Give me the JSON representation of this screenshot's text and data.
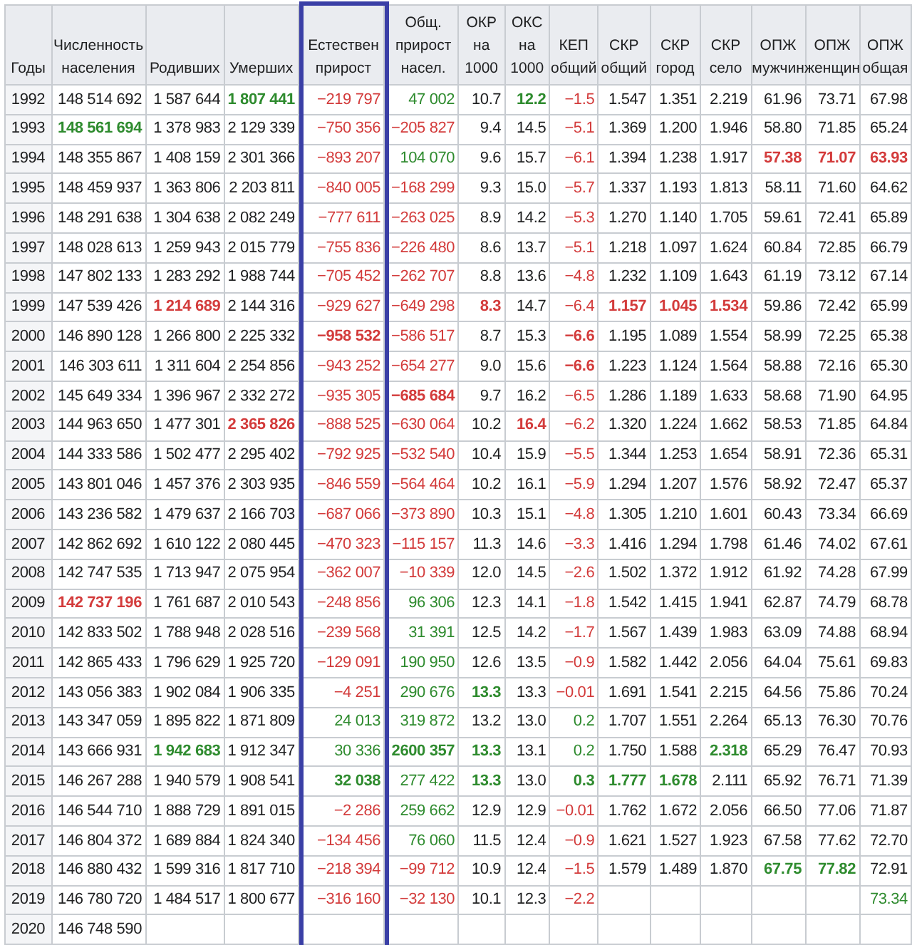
{
  "columns": [
    {
      "header": "Годы",
      "outlined": false
    },
    {
      "header": "Численность населения",
      "outlined": false
    },
    {
      "header": "Родивших",
      "outlined": false
    },
    {
      "header": "Умерших",
      "outlined": false
    },
    {
      "header": "Естествен прирост",
      "outlined": true
    },
    {
      "header": "Общ. прирост насел.",
      "outlined": false
    },
    {
      "header": "ОКР на 1000",
      "outlined": false
    },
    {
      "header": "ОКС на 1000",
      "outlined": false
    },
    {
      "header": "КЕП общий",
      "outlined": false
    },
    {
      "header": "СКР общий",
      "outlined": false
    },
    {
      "header": "СКР город",
      "outlined": false
    },
    {
      "header": "СКР село",
      "outlined": false
    },
    {
      "header": "ОПЖ мужчин",
      "outlined": false
    },
    {
      "header": "ОПЖ женщин",
      "outlined": false
    },
    {
      "header": "ОПЖ общая",
      "outlined": false
    }
  ],
  "rows": [
    {
      "cells": [
        "1992",
        "148 514 692",
        "1 587 644",
        {
          "text": "1 807 441",
          "color": "#2e8b2e",
          "bold": true
        },
        {
          "text": "−219 797",
          "color": "#d33b3b"
        },
        {
          "text": "47 002",
          "color": "#2e8b2e"
        },
        "10.7",
        {
          "text": "12.2",
          "color": "#2e8b2e",
          "bold": true
        },
        {
          "text": "−1.5",
          "color": "#d33b3b"
        },
        "1.547",
        "1.351",
        "2.219",
        "61.96",
        "73.71",
        "67.98"
      ]
    },
    {
      "cells": [
        "1993",
        {
          "text": "148 561 694",
          "color": "#2e8b2e",
          "bold": true
        },
        "1 378 983",
        "2 129 339",
        {
          "text": "−750 356",
          "color": "#d33b3b"
        },
        {
          "text": "−205 827",
          "color": "#d33b3b"
        },
        "9.4",
        "14.5",
        {
          "text": "−5.1",
          "color": "#d33b3b"
        },
        "1.369",
        "1.200",
        "1.946",
        "58.80",
        "71.85",
        "65.24"
      ]
    },
    {
      "cells": [
        "1994",
        "148 355 867",
        "1 408 159",
        "2 301 366",
        {
          "text": "−893 207",
          "color": "#d33b3b"
        },
        {
          "text": "104 070",
          "color": "#2e8b2e"
        },
        "9.6",
        "15.7",
        {
          "text": "−6.1",
          "color": "#d33b3b"
        },
        "1.394",
        "1.238",
        "1.917",
        {
          "text": "57.38",
          "color": "#d33b3b",
          "bold": true
        },
        {
          "text": "71.07",
          "color": "#d33b3b",
          "bold": true
        },
        {
          "text": "63.93",
          "color": "#d33b3b",
          "bold": true
        }
      ]
    },
    {
      "cells": [
        "1995",
        "148 459 937",
        "1 363 806",
        "2 203 811",
        {
          "text": "−840 005",
          "color": "#d33b3b"
        },
        {
          "text": "−168 299",
          "color": "#d33b3b"
        },
        "9.3",
        "15.0",
        {
          "text": "−5.7",
          "color": "#d33b3b"
        },
        "1.337",
        "1.193",
        "1.813",
        "58.11",
        "71.60",
        "64.62"
      ]
    },
    {
      "cells": [
        "1996",
        "148 291 638",
        "1 304 638",
        "2 082 249",
        {
          "text": "−777 611",
          "color": "#d33b3b"
        },
        {
          "text": "−263 025",
          "color": "#d33b3b"
        },
        "8.9",
        "14.2",
        {
          "text": "−5.3",
          "color": "#d33b3b"
        },
        "1.270",
        "1.140",
        "1.705",
        "59.61",
        "72.41",
        "65.89"
      ]
    },
    {
      "cells": [
        "1997",
        "148 028 613",
        "1 259 943",
        "2 015 779",
        {
          "text": "−755 836",
          "color": "#d33b3b"
        },
        {
          "text": "−226 480",
          "color": "#d33b3b"
        },
        "8.6",
        "13.7",
        {
          "text": "−5.1",
          "color": "#d33b3b"
        },
        "1.218",
        "1.097",
        "1.624",
        "60.84",
        "72.85",
        "66.79"
      ]
    },
    {
      "cells": [
        "1998",
        "147 802 133",
        "1 283 292",
        "1 988 744",
        {
          "text": "−705 452",
          "color": "#d33b3b"
        },
        {
          "text": "−262 707",
          "color": "#d33b3b"
        },
        "8.8",
        "13.6",
        {
          "text": "−4.8",
          "color": "#d33b3b"
        },
        "1.232",
        "1.109",
        "1.643",
        "61.19",
        "73.12",
        "67.14"
      ]
    },
    {
      "cells": [
        "1999",
        "147 539 426",
        {
          "text": "1 214 689",
          "color": "#d33b3b",
          "bold": true
        },
        "2 144 316",
        {
          "text": "−929 627",
          "color": "#d33b3b"
        },
        {
          "text": "−649 298",
          "color": "#d33b3b"
        },
        {
          "text": "8.3",
          "color": "#d33b3b",
          "bold": true
        },
        "14.7",
        {
          "text": "−6.4",
          "color": "#d33b3b"
        },
        {
          "text": "1.157",
          "color": "#d33b3b",
          "bold": true
        },
        {
          "text": "1.045",
          "color": "#d33b3b",
          "bold": true
        },
        {
          "text": "1.534",
          "color": "#d33b3b",
          "bold": true
        },
        "59.86",
        "72.42",
        "65.99"
      ]
    },
    {
      "cells": [
        "2000",
        "146 890 128",
        "1 266 800",
        "2 225 332",
        {
          "text": "−958 532",
          "color": "#d33b3b",
          "bold": true
        },
        {
          "text": "−586 517",
          "color": "#d33b3b"
        },
        "8.7",
        "15.3",
        {
          "text": "−6.6",
          "color": "#d33b3b",
          "bold": true
        },
        "1.195",
        "1.089",
        "1.554",
        "58.99",
        "72.25",
        "65.38"
      ]
    },
    {
      "cells": [
        "2001",
        "146 303 611",
        "1 311 604",
        "2 254 856",
        {
          "text": "−943 252",
          "color": "#d33b3b"
        },
        {
          "text": "−654 277",
          "color": "#d33b3b"
        },
        "9.0",
        "15.6",
        {
          "text": "−6.6",
          "color": "#d33b3b",
          "bold": true
        },
        "1.223",
        "1.124",
        "1.564",
        "58.88",
        "72.16",
        "65.30"
      ]
    },
    {
      "cells": [
        "2002",
        "145 649 334",
        "1 396 967",
        "2 332 272",
        {
          "text": "−935 305",
          "color": "#d33b3b"
        },
        {
          "text": "−685 684",
          "color": "#d33b3b",
          "bold": true
        },
        "9.7",
        "16.2",
        {
          "text": "−6.5",
          "color": "#d33b3b"
        },
        "1.286",
        "1.189",
        "1.633",
        "58.68",
        "71.90",
        "64.95"
      ]
    },
    {
      "cells": [
        "2003",
        "144 963 650",
        "1 477 301",
        {
          "text": "2 365 826",
          "color": "#d33b3b",
          "bold": true
        },
        {
          "text": "−888 525",
          "color": "#d33b3b"
        },
        {
          "text": "−630 064",
          "color": "#d33b3b"
        },
        "10.2",
        {
          "text": "16.4",
          "color": "#d33b3b",
          "bold": true
        },
        {
          "text": "−6.2",
          "color": "#d33b3b"
        },
        "1.320",
        "1.224",
        "1.662",
        "58.53",
        "71.85",
        "64.84"
      ]
    },
    {
      "cells": [
        "2004",
        "144 333 586",
        "1 502 477",
        "2 295 402",
        {
          "text": "−792 925",
          "color": "#d33b3b"
        },
        {
          "text": "−532 540",
          "color": "#d33b3b"
        },
        "10.4",
        "15.9",
        {
          "text": "−5.5",
          "color": "#d33b3b"
        },
        "1.344",
        "1.253",
        "1.654",
        "58.91",
        "72.36",
        "65.31"
      ]
    },
    {
      "cells": [
        "2005",
        "143 801 046",
        "1 457 376",
        "2 303 935",
        {
          "text": "−846 559",
          "color": "#d33b3b"
        },
        {
          "text": "−564 464",
          "color": "#d33b3b"
        },
        "10.2",
        "16.1",
        {
          "text": "−5.9",
          "color": "#d33b3b"
        },
        "1.294",
        "1.207",
        "1.576",
        "58.92",
        "72.47",
        "65.37"
      ]
    },
    {
      "cells": [
        "2006",
        "143 236 582",
        "1 479 637",
        "2 166 703",
        {
          "text": "−687 066",
          "color": "#d33b3b"
        },
        {
          "text": "−373 890",
          "color": "#d33b3b"
        },
        "10.3",
        "15.1",
        {
          "text": "−4.8",
          "color": "#d33b3b"
        },
        "1.305",
        "1.210",
        "1.601",
        "60.43",
        "73.34",
        "66.69"
      ]
    },
    {
      "cells": [
        "2007",
        "142 862 692",
        "1 610 122",
        "2 080 445",
        {
          "text": "−470 323",
          "color": "#d33b3b"
        },
        {
          "text": "−115 157",
          "color": "#d33b3b"
        },
        "11.3",
        "14.6",
        {
          "text": "−3.3",
          "color": "#d33b3b"
        },
        "1.416",
        "1.294",
        "1.798",
        "61.46",
        "74.02",
        "67.61"
      ]
    },
    {
      "cells": [
        "2008",
        "142 747 535",
        "1 713 947",
        "2 075 954",
        {
          "text": "−362 007",
          "color": "#d33b3b"
        },
        {
          "text": "−10 339",
          "color": "#d33b3b"
        },
        "12.0",
        "14.5",
        {
          "text": "−2.6",
          "color": "#d33b3b"
        },
        "1.502",
        "1.372",
        "1.912",
        "61.92",
        "74.28",
        "67.99"
      ]
    },
    {
      "cells": [
        "2009",
        {
          "text": "142 737 196",
          "color": "#d33b3b",
          "bold": true
        },
        "1 761 687",
        "2 010 543",
        {
          "text": "−248 856",
          "color": "#d33b3b"
        },
        {
          "text": "96 306",
          "color": "#2e8b2e"
        },
        "12.3",
        "14.1",
        {
          "text": "−1.8",
          "color": "#d33b3b"
        },
        "1.542",
        "1.415",
        "1.941",
        "62.87",
        "74.79",
        "68.78"
      ]
    },
    {
      "cells": [
        "2010",
        "142 833 502",
        "1 788 948",
        "2 028 516",
        {
          "text": "−239 568",
          "color": "#d33b3b"
        },
        {
          "text": "31 391",
          "color": "#2e8b2e"
        },
        "12.5",
        "14.2",
        {
          "text": "−1.7",
          "color": "#d33b3b"
        },
        "1.567",
        "1.439",
        "1.983",
        "63.09",
        "74.88",
        "68.94"
      ]
    },
    {
      "cells": [
        "2011",
        "142 865 433",
        "1 796 629",
        "1 925 720",
        {
          "text": "−129 091",
          "color": "#d33b3b"
        },
        {
          "text": "190 950",
          "color": "#2e8b2e"
        },
        "12.6",
        "13.5",
        {
          "text": "−0.9",
          "color": "#d33b3b"
        },
        "1.582",
        "1.442",
        "2.056",
        "64.04",
        "75.61",
        "69.83"
      ]
    },
    {
      "cells": [
        "2012",
        "143 056 383",
        "1 902 084",
        "1 906 335",
        {
          "text": "−4 251",
          "color": "#d33b3b"
        },
        {
          "text": "290 676",
          "color": "#2e8b2e"
        },
        {
          "text": "13.3",
          "color": "#2e8b2e",
          "bold": true
        },
        "13.3",
        {
          "text": "−0.01",
          "color": "#d33b3b"
        },
        "1.691",
        "1.541",
        "2.215",
        "64.56",
        "75.86",
        "70.24"
      ]
    },
    {
      "cells": [
        "2013",
        "143 347 059",
        "1 895 822",
        "1 871 809",
        {
          "text": "24 013",
          "color": "#2e8b2e"
        },
        {
          "text": "319 872",
          "color": "#2e8b2e"
        },
        "13.2",
        "13.0",
        {
          "text": "0.2",
          "color": "#2e8b2e"
        },
        "1.707",
        "1.551",
        "2.264",
        "65.13",
        "76.30",
        "70.76"
      ]
    },
    {
      "cells": [
        "2014",
        "143 666 931",
        {
          "text": "1 942 683",
          "color": "#2e8b2e",
          "bold": true
        },
        "1 912 347",
        {
          "text": "30 336",
          "color": "#2e8b2e"
        },
        {
          "text": "2600 357",
          "color": "#2e8b2e",
          "bold": true
        },
        {
          "text": "13.3",
          "color": "#2e8b2e",
          "bold": true
        },
        "13.1",
        {
          "text": "0.2",
          "color": "#2e8b2e"
        },
        "1.750",
        "1.588",
        {
          "text": "2.318",
          "color": "#2e8b2e",
          "bold": true
        },
        "65.29",
        "76.47",
        "70.93"
      ]
    },
    {
      "cells": [
        "2015",
        "146 267 288",
        "1 940 579",
        "1 908 541",
        {
          "text": "32 038",
          "color": "#2e8b2e",
          "bold": true
        },
        {
          "text": "277 422",
          "color": "#2e8b2e"
        },
        {
          "text": "13.3",
          "color": "#2e8b2e",
          "bold": true
        },
        "13.0",
        {
          "text": "0.3",
          "color": "#2e8b2e",
          "bold": true
        },
        {
          "text": "1.777",
          "color": "#2e8b2e",
          "bold": true
        },
        {
          "text": "1.678",
          "color": "#2e8b2e",
          "bold": true
        },
        "2.111",
        "65.92",
        "76.71",
        "71.39"
      ]
    },
    {
      "cells": [
        "2016",
        "146 544 710",
        "1 888 729",
        "1 891 015",
        {
          "text": "−2 286",
          "color": "#d33b3b"
        },
        {
          "text": "259 662",
          "color": "#2e8b2e"
        },
        "12.9",
        "12.9",
        {
          "text": "−0.01",
          "color": "#d33b3b"
        },
        "1.762",
        "1.672",
        "2.056",
        "66.50",
        "77.06",
        "71.87"
      ]
    },
    {
      "cells": [
        "2017",
        "146 804 372",
        "1 689 884",
        "1 824 340",
        {
          "text": "−134 456",
          "color": "#d33b3b"
        },
        {
          "text": "76 060",
          "color": "#2e8b2e"
        },
        "11.5",
        "12.4",
        {
          "text": "−0.9",
          "color": "#d33b3b"
        },
        "1.621",
        "1.527",
        "1.923",
        "67.58",
        "77.62",
        "72.70"
      ]
    },
    {
      "cells": [
        "2018",
        "146 880 432",
        "1 599 316",
        "1 817 710",
        {
          "text": "−218 394",
          "color": "#d33b3b"
        },
        {
          "text": "−99 712",
          "color": "#d33b3b"
        },
        "10.9",
        "12.4",
        {
          "text": "−1.5",
          "color": "#d33b3b"
        },
        "1.579",
        "1.489",
        "1.870",
        {
          "text": "67.75",
          "color": "#2e8b2e",
          "bold": true
        },
        {
          "text": "77.82",
          "color": "#2e8b2e",
          "bold": true
        },
        "72.91"
      ]
    },
    {
      "cells": [
        "2019",
        "146 780 720",
        "1 484 517",
        "1 800 677",
        {
          "text": "−316 160",
          "color": "#d33b3b"
        },
        {
          "text": "−32 130",
          "color": "#d33b3b"
        },
        "10.1",
        "12.3",
        {
          "text": "−2.2",
          "color": "#d33b3b"
        },
        null,
        null,
        null,
        null,
        null,
        {
          "text": "73.34",
          "color": "#2e8b2e"
        }
      ]
    },
    {
      "cells": [
        "2020",
        "146 748 590"
      ]
    }
  ]
}
